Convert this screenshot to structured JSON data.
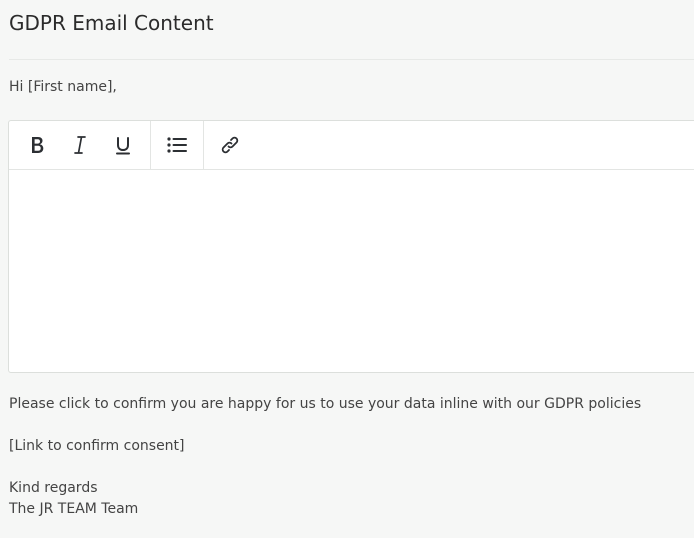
{
  "page": {
    "title": "GDPR Email Content",
    "greeting": "Hi [First name],"
  },
  "toolbar": {
    "buttons": [
      {
        "name": "bold",
        "icon": "bold-icon"
      },
      {
        "name": "italic",
        "icon": "italic-icon"
      },
      {
        "name": "underline",
        "icon": "underline-icon"
      },
      {
        "name": "bulleted-list",
        "icon": "list-icon"
      },
      {
        "name": "link",
        "icon": "link-icon"
      }
    ]
  },
  "editor": {
    "content": ""
  },
  "email_body": {
    "line1": "Please click to confirm you are happy for us to use your data inline with our GDPR policies",
    "link_placeholder": "[Link to confirm consent]",
    "signoff": "Kind regards",
    "signature": "The JR TEAM Team"
  },
  "colors": {
    "background": "#f6f7f6",
    "editor_bg": "#ffffff",
    "border": "#dcdfdc",
    "text": "#444444",
    "icon": "#2c2f33"
  }
}
